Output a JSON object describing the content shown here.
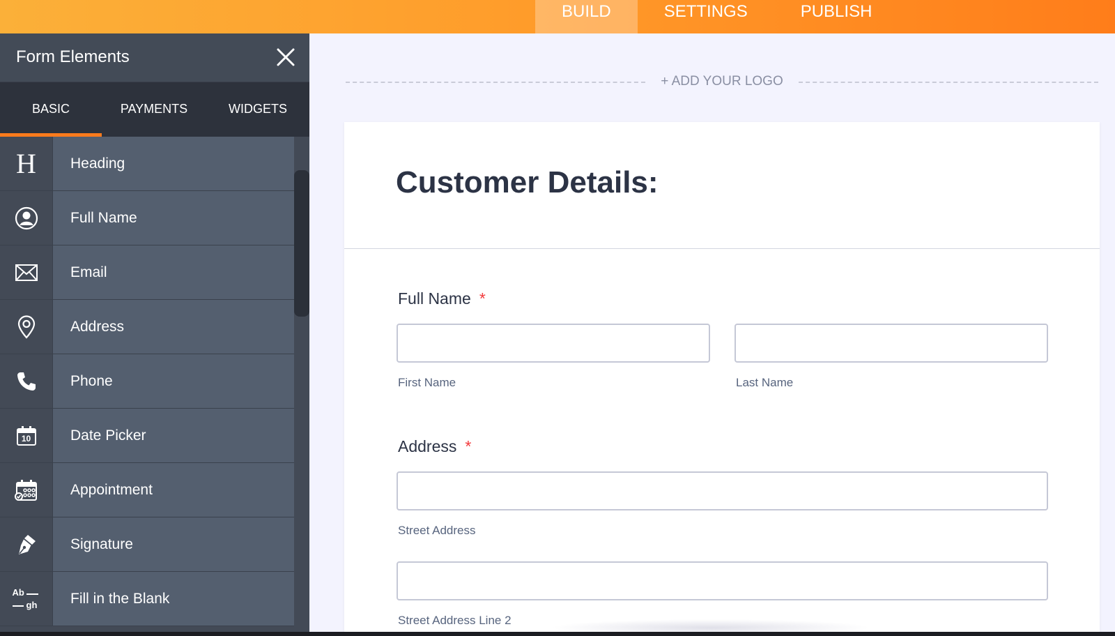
{
  "topnav": {
    "items": [
      "BUILD",
      "SETTINGS",
      "PUBLISH"
    ],
    "active": "BUILD"
  },
  "sidebar": {
    "title": "Form Elements",
    "tabs": [
      "BASIC",
      "PAYMENTS",
      "WIDGETS"
    ],
    "active_tab": "BASIC",
    "items": [
      {
        "label": "Heading",
        "icon": "heading-icon"
      },
      {
        "label": "Full Name",
        "icon": "user-icon"
      },
      {
        "label": "Email",
        "icon": "envelope-icon"
      },
      {
        "label": "Address",
        "icon": "location-pin-icon"
      },
      {
        "label": "Phone",
        "icon": "phone-icon"
      },
      {
        "label": "Date Picker",
        "icon": "calendar-icon"
      },
      {
        "label": "Appointment",
        "icon": "appointment-calendar-icon"
      },
      {
        "label": "Signature",
        "icon": "pen-icon"
      },
      {
        "label": "Fill in the Blank",
        "icon": "fill-blank-icon"
      }
    ],
    "heading_icon_glyph": "H",
    "calendar_icon_day": "10",
    "fill_blank_icon_top": "Ab",
    "fill_blank_icon_bottom": "gh"
  },
  "main": {
    "add_logo": "+ ADD YOUR LOGO",
    "form": {
      "title": "Customer Details:",
      "full_name": {
        "label": "Full Name",
        "required_mark": "*",
        "first_value": "",
        "first_sublabel": "First Name",
        "last_value": "",
        "last_sublabel": "Last Name"
      },
      "address": {
        "label": "Address",
        "required_mark": "*",
        "street_value": "",
        "street_sublabel": "Street Address",
        "street2_value": "",
        "street2_sublabel": "Street Address Line 2"
      }
    }
  },
  "colors": {
    "accent": "#ff7b1c",
    "topbar_start": "#fbb039",
    "topbar_end": "#ff7d1a",
    "sidebar_bg": "#434a56",
    "sidebar_item_bg": "#545f6f",
    "title_text": "#2c3345",
    "required": "#f23a3c"
  }
}
